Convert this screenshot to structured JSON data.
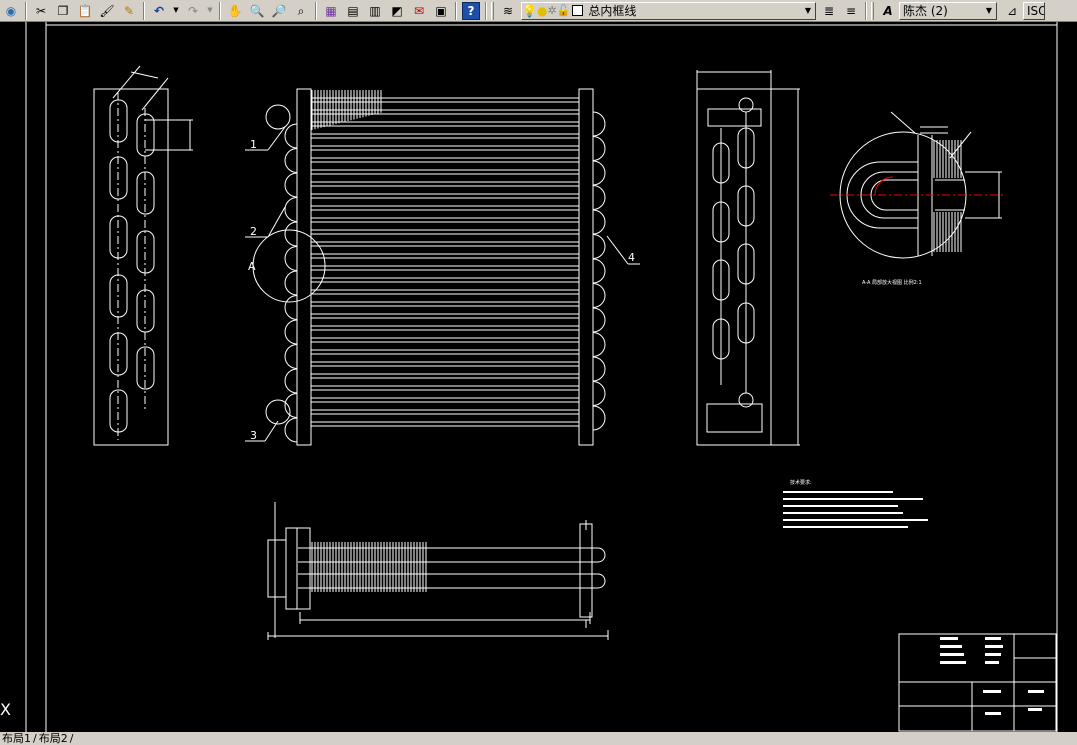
{
  "toolbar": {
    "layer_name": "总内框线",
    "text_style": "陈杰 (2)",
    "right_clip": "ISO",
    "icons": [
      "globe-icon",
      "cut-icon",
      "copy-icon",
      "paste-icon",
      "matchprop-icon",
      "brush-icon",
      "undo-icon",
      "redo-icon",
      "pan-icon",
      "zoom-realtime-icon",
      "zoom-window-icon",
      "zoom-previous-icon",
      "properties-icon",
      "design-center-icon",
      "tool-palettes-icon",
      "sheet-set-icon",
      "markup-icon",
      "calculator-icon",
      "help-icon",
      "layer-manager-icon",
      "bulb-icon",
      "sun-icon",
      "lock-icon",
      "layer-color-icon",
      "layer-state-icon",
      "layer-previous-icon",
      "text-style-icon",
      "dim-style-icon"
    ]
  },
  "drawing": {
    "callouts": [
      "1",
      "2",
      "3",
      "4",
      "A"
    ],
    "tech_notes_title": "技术要求:",
    "detail_caption": "A-A 局部放大视图 比例2:1",
    "colors": {
      "background": "#000000",
      "lines": "#ffffff",
      "hidden": "#ff0000"
    }
  },
  "tabs": {
    "layout1": "布局1",
    "layout2": "布局2"
  }
}
